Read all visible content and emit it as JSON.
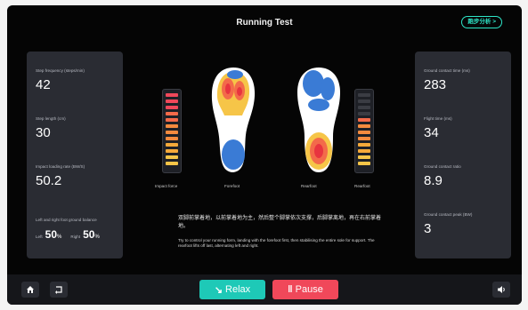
{
  "header": {
    "title": "Running Test",
    "report_button": "跑步分析 >"
  },
  "left_panel": {
    "metrics": [
      {
        "label": "Step frequency (steps/min)",
        "value": "42"
      },
      {
        "label": "Step length (cm)",
        "value": "30"
      },
      {
        "label": "Impact loading rate (BW/S)",
        "value": "50.2"
      }
    ],
    "balance": {
      "label": "Left and right foot ground balance",
      "left_label": "Left",
      "left_value": "50",
      "right_label": "Right",
      "right_value": "50",
      "unit": "%"
    }
  },
  "right_panel": {
    "metrics": [
      {
        "label": "Ground contact time (ms)",
        "value": "283"
      },
      {
        "label": "Flight time (ms)",
        "value": "34"
      },
      {
        "label": "Ground contact ratio",
        "value": "8.9"
      },
      {
        "label": "Ground contact peak (BW)",
        "value": "3"
      }
    ]
  },
  "visual": {
    "captions": [
      "Impact force",
      "Forefoot",
      "Rearfoot",
      "Rearfoot"
    ],
    "gauge_left_level": 1.0,
    "gauge_right_level": 0.7,
    "gauge_colors": [
      "#f0485a",
      "#f36a4a",
      "#f48a3e",
      "#f5a93a",
      "#f6c548"
    ]
  },
  "hint": {
    "cn": "双脚前掌着地，以前掌着地为主，然后整个脚掌依次支撑，后脚掌离地，再在右前掌着地。",
    "en": "Try to control your running form, landing with the forefoot first, then stabilising the entire sole for support. The rearfoot lifts off last, alternating left and right."
  },
  "footer": {
    "relax_label": "Relax",
    "pause_label": "Pause",
    "home_icon": "home-icon",
    "back_icon": "back-icon",
    "volume_icon": "volume-icon"
  }
}
